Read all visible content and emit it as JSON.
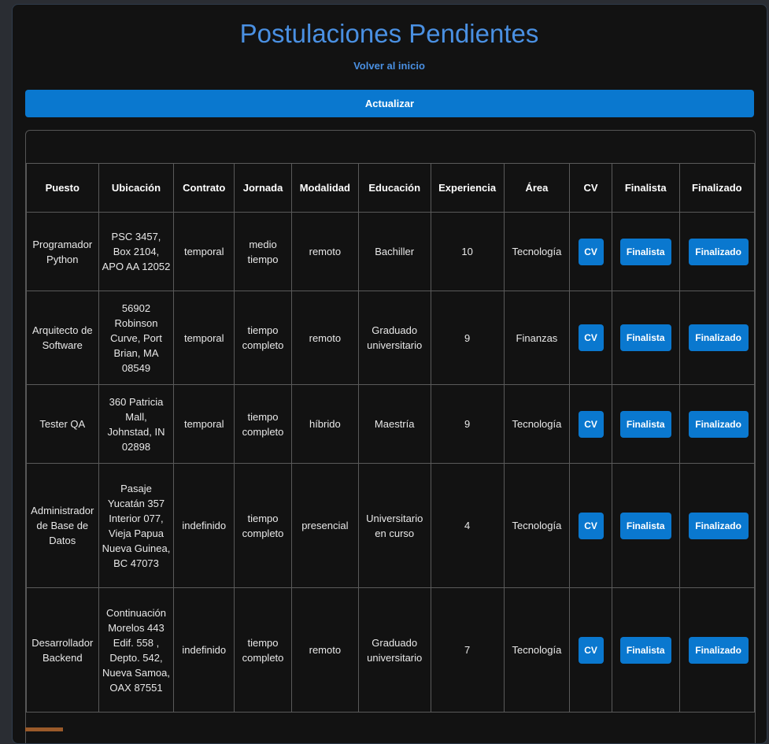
{
  "page": {
    "title": "Postulaciones Pendientes",
    "back_link": "Volver al inicio",
    "refresh_button": "Actualizar"
  },
  "table": {
    "headers": [
      "Puesto",
      "Ubicación",
      "Contrato",
      "Jornada",
      "Modalidad",
      "Educación",
      "Experiencia",
      "Área",
      "CV",
      "Finalista",
      "Finalizado"
    ],
    "rows": [
      {
        "puesto": "Programador Python",
        "ubicacion": "PSC 3457, Box 2104, APO AA 12052",
        "contrato": "temporal",
        "jornada": "medio tiempo",
        "modalidad": "remoto",
        "educacion": "Bachiller",
        "experiencia": "10",
        "area": "Tecnología",
        "cv": "CV",
        "finalista": "Finalista",
        "finalizado": "Finalizado"
      },
      {
        "puesto": "Arquitecto de Software",
        "ubicacion": "56902 Robinson Curve, Port Brian, MA 08549",
        "contrato": "temporal",
        "jornada": "tiempo completo",
        "modalidad": "remoto",
        "educacion": "Graduado universitario",
        "experiencia": "9",
        "area": "Finanzas",
        "cv": "CV",
        "finalista": "Finalista",
        "finalizado": "Finalizado"
      },
      {
        "puesto": "Tester QA",
        "ubicacion": "360 Patricia Mall, Johnstad, IN 02898",
        "contrato": "temporal",
        "jornada": "tiempo completo",
        "modalidad": "híbrido",
        "educacion": "Maestría",
        "experiencia": "9",
        "area": "Tecnología",
        "cv": "CV",
        "finalista": "Finalista",
        "finalizado": "Finalizado"
      },
      {
        "puesto": "Administrador de Base de Datos",
        "ubicacion": "Pasaje Yucatán 357 Interior 077, Vieja Papua Nueva Guinea, BC 47073",
        "contrato": "indefinido",
        "jornada": "tiempo completo",
        "modalidad": "presencial",
        "educacion": "Universitario en curso",
        "experiencia": "4",
        "area": "Tecnología",
        "cv": "CV",
        "finalista": "Finalista",
        "finalizado": "Finalizado"
      },
      {
        "puesto": "Desarrollador Backend",
        "ubicacion": "Continuación Morelos 443 Edif. 558 , Depto. 542, Nueva Samoa, OAX 87551",
        "contrato": "indefinido",
        "jornada": "tiempo completo",
        "modalidad": "remoto",
        "educacion": "Graduado universitario",
        "experiencia": "7",
        "area": "Tecnología",
        "cv": "CV",
        "finalista": "Finalista",
        "finalizado": "Finalizado"
      }
    ]
  },
  "colors": {
    "accent": "#4a90e2",
    "button": "#0a78cf",
    "background": "#121212"
  }
}
